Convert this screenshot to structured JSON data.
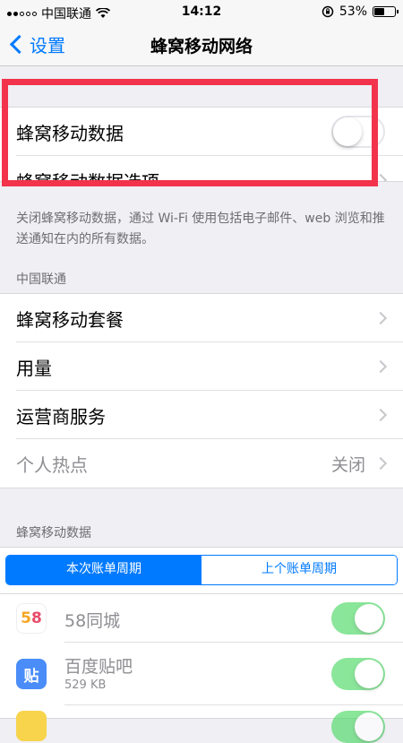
{
  "status_bar": {
    "carrier": "中国联通",
    "time": "14:12",
    "battery_percent": "53%",
    "battery_level": 0.53
  },
  "nav": {
    "back_label": "设置",
    "title": "蜂窝移动网络"
  },
  "cellular_group": {
    "cellular_data_label": "蜂窝移动数据",
    "cellular_data_enabled": false,
    "cellular_options_label": "蜂窝移动数据选项"
  },
  "cellular_footer": "关闭蜂窝移动数据，通过 Wi-Fi 使用包括电子邮件、web 浏览和推送通知在内的所有数据。",
  "carrier_section": {
    "header": "中国联通",
    "items": [
      {
        "label": "蜂窝移动套餐"
      },
      {
        "label": "用量"
      },
      {
        "label": "运营商服务"
      },
      {
        "label": "个人热点",
        "value": "关闭"
      }
    ]
  },
  "data_section": {
    "header": "蜂窝移动数据",
    "tabs": [
      "本次账单周期",
      "上个账单周期"
    ],
    "active_tab": 0
  },
  "apps": [
    {
      "name": "58同城",
      "icon_text": "58",
      "enabled": true
    },
    {
      "name": "百度贴吧",
      "icon_text": "贴",
      "size": "529 KB",
      "enabled": true
    }
  ],
  "colors": {
    "accent": "#007aff",
    "toggle_on": "#4cd964",
    "highlight": "#f2334b"
  }
}
